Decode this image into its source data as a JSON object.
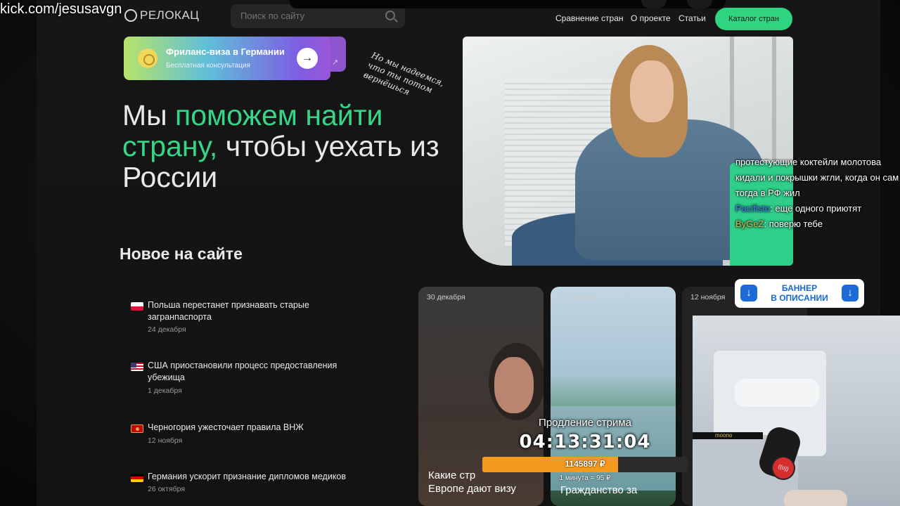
{
  "stream": {
    "url": "kick.com/jesusavgn"
  },
  "site": {
    "logo": "РЕЛОКАЦ",
    "search_placeholder": "Поиск по сайту",
    "nav": [
      "Сравнение стран",
      "О проекте",
      "Статьи"
    ],
    "catalog_button": "Каталог стран",
    "promo": {
      "title": "Фриланс-виза в Германии",
      "subtitle": "Бесплатная консультация",
      "arrow": "→",
      "tail_arrow": "↗"
    },
    "handwriting": "Но мы надеемся, что ты потом вернёшься",
    "hero": {
      "part1": "Мы ",
      "highlight1": "поможем найти страну,",
      "part2": " чтобы уехать из России"
    },
    "section_title": "Новое на сайте",
    "news": [
      {
        "flag": "pl",
        "title": "Польша перестанет признавать старые загранпаспорта",
        "date": "24 декабря"
      },
      {
        "flag": "us",
        "title": "США приостановили процесс предоставления убежища",
        "date": "1 декабря"
      },
      {
        "flag": "me",
        "title": "Черногория ужесточает правила ВНЖ",
        "date": "12 ноября"
      },
      {
        "flag": "de",
        "title": "Германия ускорит признание дипломов медиков",
        "date": "26 октября"
      }
    ],
    "cards": [
      {
        "date": "30 декабря",
        "caption": "Какие стр\nЕвропе дают визу"
      },
      {
        "date": "17 декабря",
        "caption": "Гражданство за"
      },
      {
        "date": "12 ноября",
        "caption": ""
      }
    ]
  },
  "chat": {
    "messages": [
      {
        "user": "",
        "text": "протестующие коктейли молотова кидали и покрышки жгли, когда он сам тогда в РФ жил"
      },
      {
        "user": "Pacifisto",
        "text": ": еще одного приютят"
      },
      {
        "user": "ByGeZ",
        "text": ": поверю тебе"
      }
    ]
  },
  "banner": {
    "line1": "БАННЕР",
    "line2": "В ОПИСАНИИ",
    "icon": "↓"
  },
  "webcam": {
    "arm_label": "moono",
    "mic_badge": "((o))"
  },
  "timer": {
    "label": "Продление стрима",
    "value": "04:13:31:04",
    "amount": "1145897 ₽",
    "progress": 0.66,
    "rate": "1 минута = 95 ₽"
  },
  "colors": {
    "accent_green": "#37d687",
    "catalog_green": "#2fd480",
    "timer_orange": "#f39a1c",
    "banner_blue": "#1769d8",
    "chat_user_blue": "#4a7dff",
    "chat_user_yellow": "#d8b84e"
  }
}
